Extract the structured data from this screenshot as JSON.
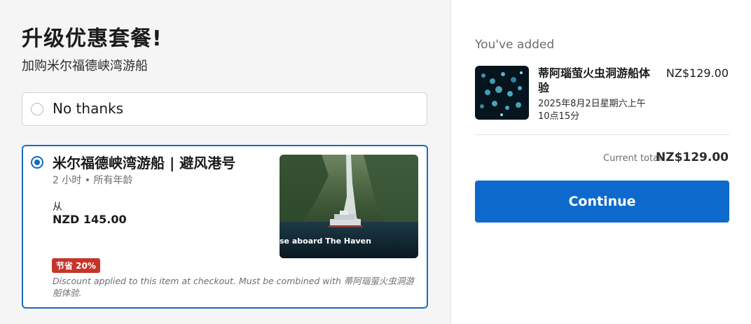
{
  "upsell": {
    "title": "升级优惠套餐!",
    "subtitle": "加购米尔福德峡湾游船",
    "no_thanks_label": "No thanks",
    "offer": {
      "title": "米尔福德峡湾游船 | 避风港号",
      "meta": "2 小时 • 所有年龄",
      "from_label": "从",
      "price": "NZD 145.00",
      "image_caption": "se aboard The Haven",
      "badge": "节省 20%",
      "disclaimer": "Discount applied to this item at checkout. Must be combined with 蒂阿瑙萤火虫洞游船体验."
    }
  },
  "cart": {
    "heading": "You've added",
    "item": {
      "title": "蒂阿瑙萤火虫洞游船体验",
      "date": "2025年8月2日星期六上午10点15分",
      "price": "NZ$129.00"
    },
    "total_label": "Current total",
    "total_value": "NZ$129.00",
    "continue_label": "Continue"
  },
  "colors": {
    "accent": "#0d6acc",
    "selected_border": "#1c6bbf",
    "badge": "#c5352a"
  }
}
